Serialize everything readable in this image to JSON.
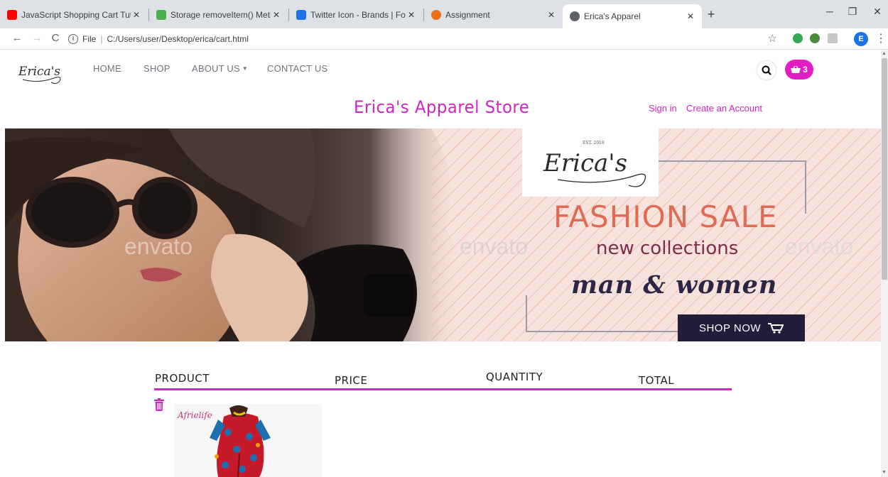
{
  "browser": {
    "tabs": [
      {
        "label": "JavaScript Shopping Cart Tutorial",
        "color": "#ff0000"
      },
      {
        "label": "Storage removeItem() Method",
        "color": "#4caf50"
      },
      {
        "label": "Twitter Icon - Brands | Font Awes",
        "color": "#1a73e8"
      },
      {
        "label": "Assignment",
        "color": "#e8711a"
      },
      {
        "label": "Erica's Apparel",
        "color": "#5f6368"
      }
    ],
    "address_prefix": "File",
    "address": "C:/Users/user/Desktop/erica/cart.html",
    "profile_initial": "E"
  },
  "site": {
    "logo_text": "Erica's",
    "nav": {
      "home": "HOME",
      "shop": "SHOP",
      "about": "ABOUT US",
      "contact": "CONTACT US"
    },
    "cart_count": "3",
    "accent_color": "#d126c0",
    "store_title": "Erica's Apparel Store",
    "sign_in": "Sign in",
    "create_account": "Create an Account"
  },
  "banner": {
    "logo_text": "Erica's",
    "logo_est": "EST. 2018",
    "headline": "FASHION SALE",
    "subline": "new collections",
    "tagline": "man & women",
    "cta": "SHOP NOW",
    "watermarks": [
      "envato",
      "envato",
      "envato"
    ]
  },
  "cart": {
    "headers": {
      "product": "PRODUCT",
      "price": "PRICE",
      "quantity": "QUANTITY",
      "total": "TOTAL"
    },
    "items": [
      {
        "brand": "Afrielife"
      }
    ]
  }
}
